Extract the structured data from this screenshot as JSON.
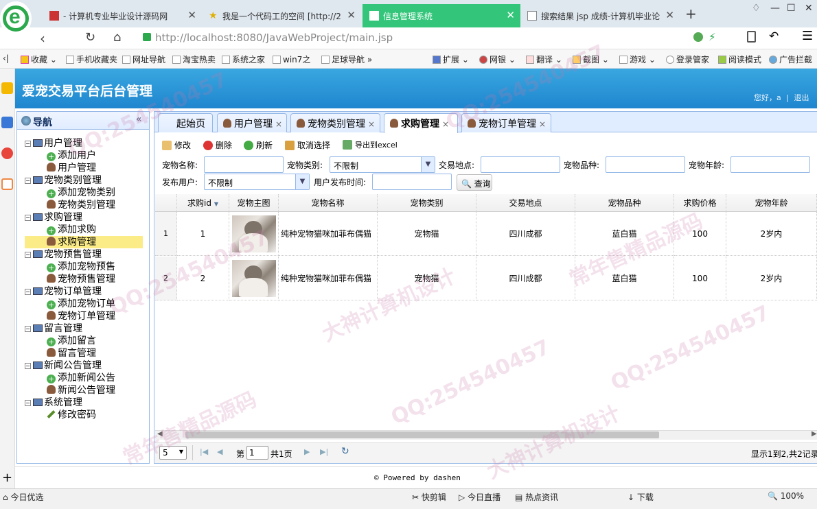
{
  "browser": {
    "tabs": [
      {
        "title": "- 计算机专业毕业设计源码网",
        "active": false
      },
      {
        "title": "我是一个代码工的空间 [http://2",
        "active": false
      },
      {
        "title": "信息管理系统",
        "active": true
      },
      {
        "title": "搜索结果 jsp 成绩-计算机毕业论",
        "active": false
      }
    ],
    "url_host": "http://localhost",
    "url_rest": ":8080/JavaWebProject/main.jsp",
    "bookmarks": [
      "收藏",
      "手机收藏夹",
      "网址导航",
      "淘宝热卖",
      "系统之家",
      "win7之",
      "足球导航"
    ],
    "tools": [
      "扩展",
      "网银",
      "翻译",
      "截图",
      "游戏",
      "登录管家",
      "阅读模式",
      "广告拦截"
    ]
  },
  "app": {
    "title": "爱宠交易平台后台管理",
    "greeting": "您好，a",
    "separator": "|",
    "logout": "退出"
  },
  "nav": {
    "title": "导航",
    "collapse": "«",
    "groups": [
      {
        "label": "用户管理",
        "children": [
          {
            "label": "添加用户",
            "icon": "add"
          },
          {
            "label": "用户管理",
            "icon": "user"
          }
        ]
      },
      {
        "label": "宠物类别管理",
        "children": [
          {
            "label": "添加宠物类别",
            "icon": "add"
          },
          {
            "label": "宠物类别管理",
            "icon": "user"
          }
        ]
      },
      {
        "label": "求购管理",
        "children": [
          {
            "label": "添加求购",
            "icon": "add"
          },
          {
            "label": "求购管理",
            "icon": "user",
            "selected": true
          }
        ]
      },
      {
        "label": "宠物预售管理",
        "children": [
          {
            "label": "添加宠物预售",
            "icon": "add"
          },
          {
            "label": "宠物预售管理",
            "icon": "user"
          }
        ]
      },
      {
        "label": "宠物订单管理",
        "children": [
          {
            "label": "添加宠物订单",
            "icon": "add"
          },
          {
            "label": "宠物订单管理",
            "icon": "user"
          }
        ]
      },
      {
        "label": "留言管理",
        "children": [
          {
            "label": "添加留言",
            "icon": "add"
          },
          {
            "label": "留言管理",
            "icon": "user"
          }
        ]
      },
      {
        "label": "新闻公告管理",
        "children": [
          {
            "label": "添加新闻公告",
            "icon": "add"
          },
          {
            "label": "新闻公告管理",
            "icon": "user"
          }
        ]
      },
      {
        "label": "系统管理",
        "children": [
          {
            "label": "修改密码",
            "icon": "pen"
          }
        ]
      }
    ]
  },
  "tabs": [
    {
      "label": "起始页",
      "closable": false
    },
    {
      "label": "用户管理",
      "closable": true
    },
    {
      "label": "宠物类别管理",
      "closable": true
    },
    {
      "label": "求购管理",
      "closable": true,
      "active": true
    },
    {
      "label": "宠物订单管理",
      "closable": true
    }
  ],
  "toolbar": {
    "edit": "修改",
    "delete": "删除",
    "refresh": "刷新",
    "unselect": "取消选择",
    "export": "导出到excel"
  },
  "filters": {
    "pet_name": "宠物名称:",
    "pet_class": "宠物类别:",
    "pet_class_value": "不限制",
    "place": "交易地点:",
    "breed": "宠物品种:",
    "age": "宠物年龄:",
    "user": "发布用户:",
    "user_value": "不限制",
    "time": "用户发布时间:",
    "query": "查询"
  },
  "grid": {
    "columns": [
      "求购id",
      "宠物主图",
      "宠物名称",
      "宠物类别",
      "交易地点",
      "宠物品种",
      "求购价格",
      "宠物年龄"
    ],
    "sort_indicator": "▼",
    "rows": [
      {
        "num": "1",
        "id": "1",
        "name": "纯种宠物猫咪加菲布偶猫",
        "class": "宠物猫",
        "place": "四川成都",
        "breed": "蓝白猫",
        "price": "100",
        "age": "2岁内"
      },
      {
        "num": "2",
        "id": "2",
        "name": "纯种宠物猫咪加菲布偶猫",
        "class": "宠物猫",
        "place": "四川成都",
        "breed": "蓝白猫",
        "price": "100",
        "age": "2岁内"
      }
    ]
  },
  "pager": {
    "page_size": "5",
    "page_prefix": "第",
    "page_value": "1",
    "page_total": "共1页",
    "summary": "显示1到2,共2记录"
  },
  "footer": {
    "powered": "© Powered by dashen"
  },
  "statusbar": {
    "left": "今日优选",
    "items": [
      "快剪辑",
      "今日直播",
      "热点资讯",
      "下载",
      "100%"
    ]
  },
  "watermarks": [
    "QQ:254540457",
    "常年售精品源码",
    "大神计算机设计"
  ]
}
